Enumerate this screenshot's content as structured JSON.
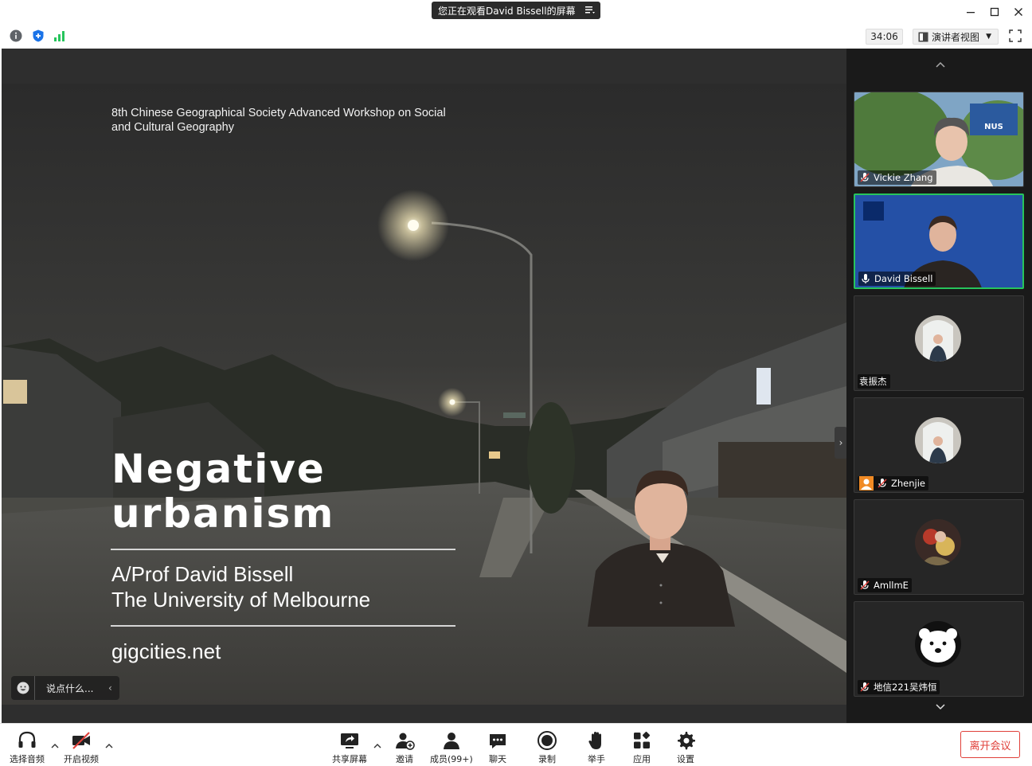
{
  "title_bar": {
    "share_banner": "您正在观看David Bissell的屏幕"
  },
  "toolbar": {
    "timer": "34:06",
    "view_mode": "演讲者视图"
  },
  "slide": {
    "subtitle": "8th Chinese Geographical Society Advanced Workshop on Social and Cultural Geography",
    "title_line1": "Negative",
    "title_line2": "urbanism",
    "author_line1": "A/Prof David Bissell",
    "author_line2": "The University of Melbourne",
    "url": "gigcities.net"
  },
  "chat_input": {
    "placeholder": "说点什么..."
  },
  "participants": [
    {
      "name": "Vickie Zhang",
      "muted": true
    },
    {
      "name": "David Bissell",
      "muted": false,
      "active_speaker": true
    },
    {
      "name": "袁振杰",
      "muted": false
    },
    {
      "name": "Zhenjie",
      "muted": true
    },
    {
      "name": "AmllmE",
      "muted": true
    },
    {
      "name": "地信221吴炜恒",
      "muted": true
    }
  ],
  "controls": {
    "audio": "选择音频",
    "video": "开启视频",
    "share": "共享屏幕",
    "invite": "邀请",
    "members": "成员(99+)",
    "chat": "聊天",
    "record": "录制",
    "raise_hand": "举手",
    "apps": "应用",
    "settings": "设置",
    "leave": "离开会议"
  },
  "colors": {
    "active_border": "#27c45c",
    "leave": "#e0403a",
    "shield": "#1a73e8",
    "signal": "#27c45c"
  }
}
